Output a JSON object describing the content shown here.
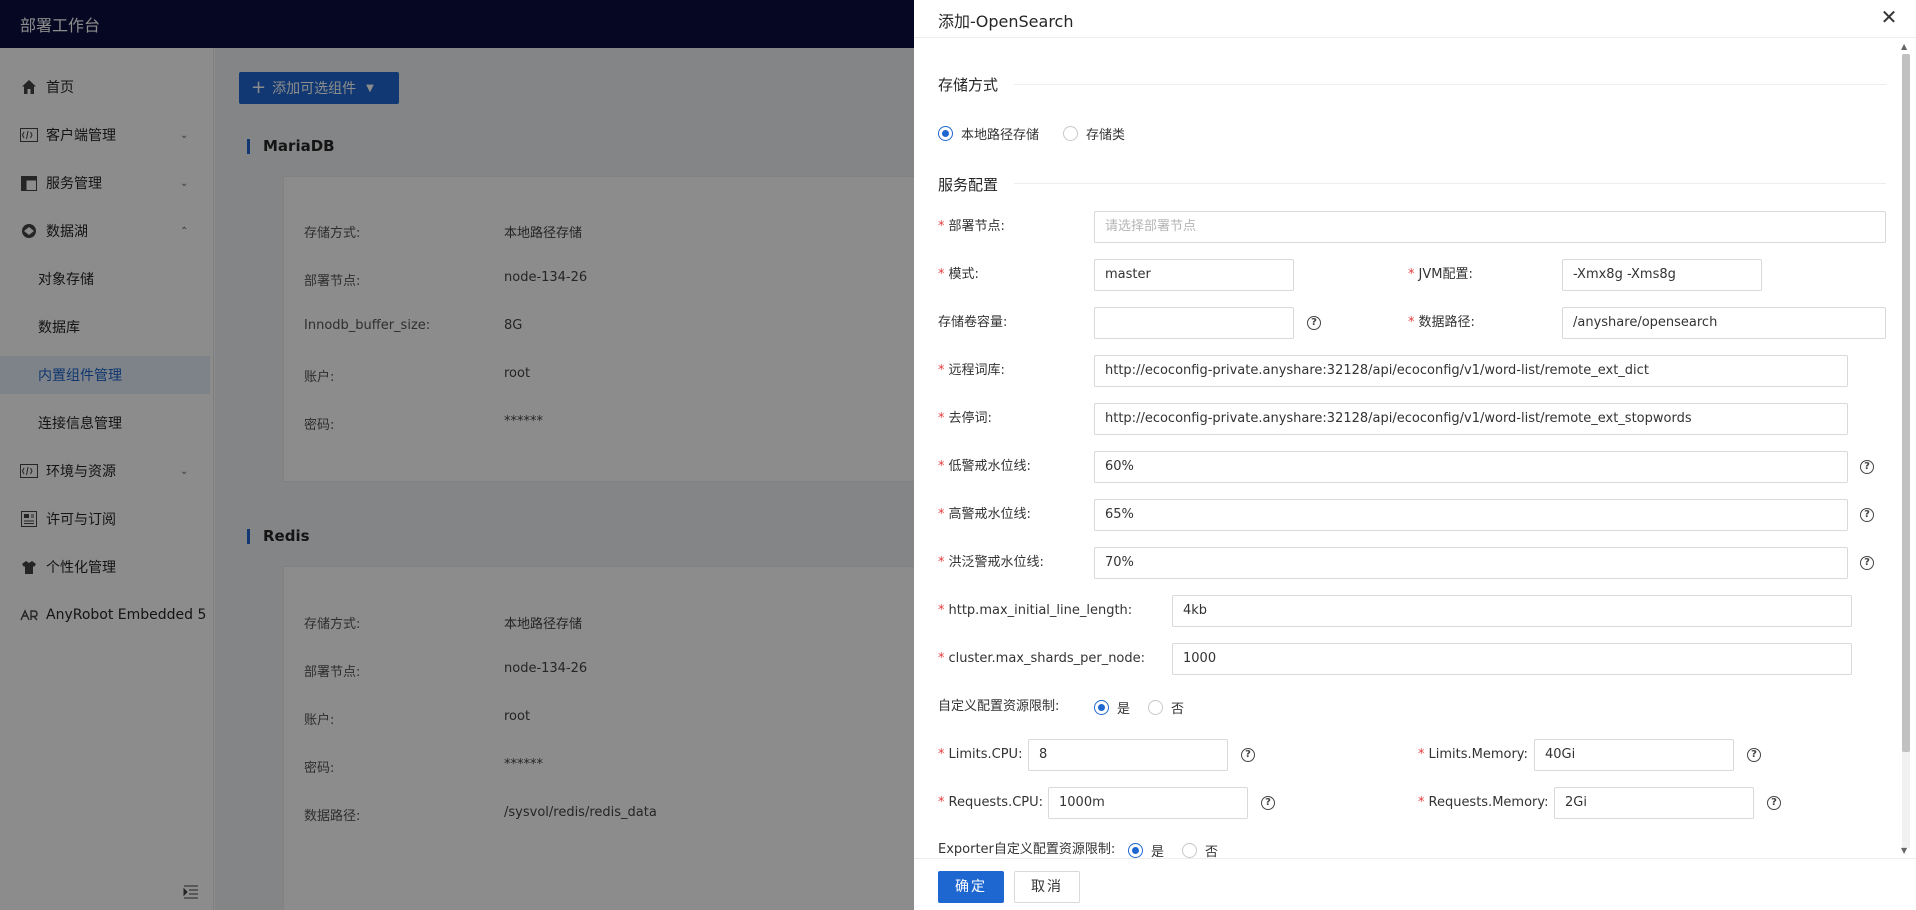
{
  "app": {
    "title": "部署工作台"
  },
  "sidebar": {
    "items": [
      {
        "label": "首页",
        "icon": "home-icon"
      },
      {
        "label": "客户端管理",
        "icon": "code-icon"
      },
      {
        "label": "服务管理",
        "icon": "table-icon"
      },
      {
        "label": "数据湖",
        "icon": "database-icon"
      },
      {
        "label": "对象存储"
      },
      {
        "label": "数据库"
      },
      {
        "label": "内置组件管理"
      },
      {
        "label": "连接信息管理"
      },
      {
        "label": "环境与资源",
        "icon": "code-icon"
      },
      {
        "label": "许可与订阅",
        "icon": "license-icon"
      },
      {
        "label": "个性化管理",
        "icon": "shirt-icon"
      },
      {
        "label": "AnyRobot Embedded 5",
        "icon": "robot-icon"
      }
    ]
  },
  "main": {
    "add_button": "添加可选组件",
    "sections": [
      {
        "title": "MariaDB",
        "rows": [
          {
            "key": "存储方式:",
            "value": "本地路径存储"
          },
          {
            "key": "部署节点:",
            "value": "node-134-26"
          },
          {
            "key": "Innodb_buffer_size:",
            "value": "8G"
          },
          {
            "key": "账户:",
            "value": "root"
          },
          {
            "key": "密码:",
            "value": "******"
          }
        ]
      },
      {
        "title": "Redis",
        "rows": [
          {
            "key": "存储方式:",
            "value": "本地路径存储"
          },
          {
            "key": "部署节点:",
            "value": "node-134-26"
          },
          {
            "key": "账户:",
            "value": "root"
          },
          {
            "key": "密码:",
            "value": "******"
          },
          {
            "key": "数据路径:",
            "value": "/sysvol/redis/redis_data"
          }
        ]
      }
    ]
  },
  "drawer": {
    "title": "添加-OpenSearch",
    "storage_group": "存储方式",
    "storage_options": [
      "本地路径存储",
      "存储类"
    ],
    "storage_selected": "本地路径存储",
    "service_group": "服务配置",
    "fields": {
      "node": {
        "label": "部署节点:",
        "placeholder": "请选择部署节点"
      },
      "mode": {
        "label": "模式:",
        "value": "master"
      },
      "jvm": {
        "label": "JVM配置:",
        "value": "-Xmx8g -Xms8g"
      },
      "volume": {
        "label": "存储卷容量:",
        "value": ""
      },
      "data_path": {
        "label": "数据路径:",
        "value": "/anyshare/opensearch"
      },
      "remote_dict": {
        "label": "远程词库:",
        "value": "http://ecoconfig-private.anyshare:32128/api/ecoconfig/v1/word-list/remote_ext_dict"
      },
      "stopwords": {
        "label": "去停词:",
        "value": "http://ecoconfig-private.anyshare:32128/api/ecoconfig/v1/word-list/remote_ext_stopwords"
      },
      "low_watermark": {
        "label": "低警戒水位线:",
        "value": "60%"
      },
      "high_watermark": {
        "label": "高警戒水位线:",
        "value": "65%"
      },
      "flood_watermark": {
        "label": "洪泛警戒水位线:",
        "value": "70%"
      },
      "max_line": {
        "label": "http.max_initial_line_length:",
        "value": "4kb"
      },
      "max_shards": {
        "label": "cluster.max_shards_per_node:",
        "value": "1000"
      },
      "limits_cpu": {
        "label": "Limits.CPU:",
        "value": "8"
      },
      "limits_mem": {
        "label": "Limits.Memory:",
        "value": "40Gi"
      },
      "req_cpu": {
        "label": "Requests.CPU:",
        "value": "1000m"
      },
      "req_mem": {
        "label": "Requests.Memory:",
        "value": "2Gi"
      }
    },
    "custom_limit": {
      "label": "自定义配置资源限制:",
      "yes": "是",
      "no": "否"
    },
    "exporter_limit": {
      "label": "Exporter自定义配置资源限制:",
      "yes": "是",
      "no": "否"
    },
    "ok": "确定",
    "cancel": "取消"
  }
}
